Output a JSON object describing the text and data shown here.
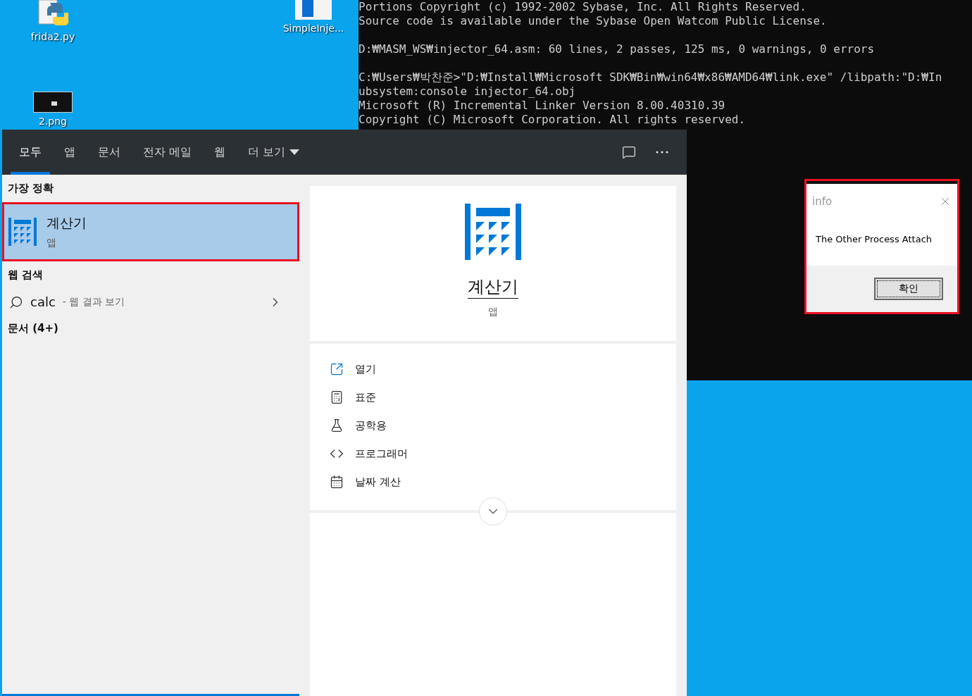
{
  "desktop": {
    "icons": [
      {
        "kind": "python",
        "label": "frida2.py"
      },
      {
        "kind": "document",
        "label": "SimpleInje..."
      },
      {
        "kind": "image",
        "label": "2.png"
      }
    ]
  },
  "console": {
    "paragraphs": [
      [
        "Portions Copyright (c) 1992-2002 Sybase, Inc. All Rights Reserved.",
        "Source code is available under the Sybase Open Watcom Public License."
      ],
      [
        "D:₩MASM_WS₩injector_64.asm: 60 lines, 2 passes, 125 ms, 0 warnings, 0 errors"
      ],
      [
        "C:₩Users₩박찬준>\"D:₩Install₩Microsoft SDK₩Bin₩win64₩x86₩AMD64₩link.exe\" /libpath:\"D:₩In",
        "ubsystem:console injector_64.obj",
        "Microsoft (R) Incremental Linker Version 8.00.40310.39",
        "Copyright (C) Microsoft Corporation.  All rights reserved."
      ]
    ]
  },
  "search": {
    "tabs": [
      {
        "label": "모두",
        "selected": true,
        "kind": "tab"
      },
      {
        "label": "앱",
        "selected": false,
        "kind": "tab"
      },
      {
        "label": "문서",
        "selected": false,
        "kind": "tab"
      },
      {
        "label": "전자 메일",
        "selected": false,
        "kind": "tab"
      },
      {
        "label": "웹",
        "selected": false,
        "kind": "tab"
      },
      {
        "label": "더 보기",
        "selected": false,
        "kind": "dropdown"
      }
    ],
    "best_match": {
      "heading": "가장 정확",
      "result": {
        "title": "계산기",
        "subtitle": "앱",
        "selected": true,
        "outlined": true
      }
    },
    "web_search": {
      "heading": "웹 검색",
      "query": "calc",
      "suffix": "- 웹 결과 보기"
    },
    "documents": {
      "heading": "문서 (4+)"
    },
    "preview": {
      "title": "계산기",
      "subtitle": "앱",
      "actions": [
        {
          "kind": "open",
          "label": "열기"
        },
        {
          "kind": "standard",
          "label": "표준"
        },
        {
          "kind": "scientific",
          "label": "공학용"
        },
        {
          "kind": "programmer",
          "label": "프로그래머"
        },
        {
          "kind": "date",
          "label": "날짜 계산"
        }
      ]
    }
  },
  "dialog": {
    "title": "info",
    "message": "The Other Process Attach",
    "button": "확인",
    "outlined": true
  }
}
